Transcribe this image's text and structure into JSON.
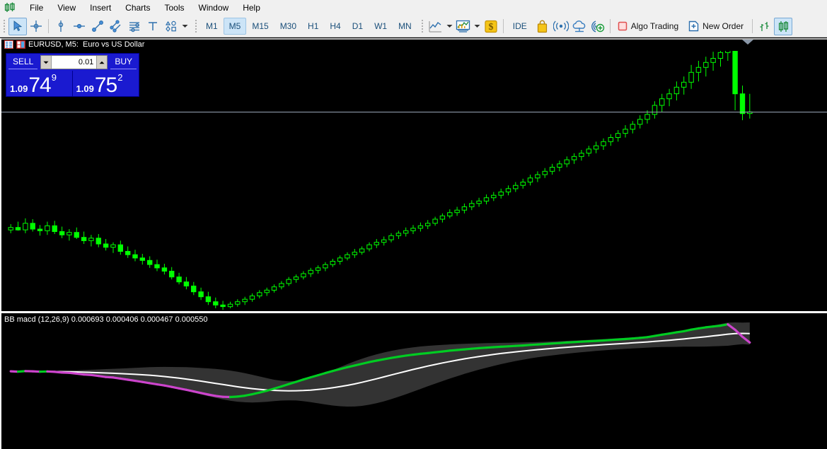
{
  "app": {
    "logo_icon": "candlestick-logo-icon"
  },
  "menubar": {
    "items": [
      {
        "label": "File"
      },
      {
        "label": "View"
      },
      {
        "label": "Insert"
      },
      {
        "label": "Charts"
      },
      {
        "label": "Tools"
      },
      {
        "label": "Window"
      },
      {
        "label": "Help"
      }
    ]
  },
  "toolbar": {
    "cursor_icon": "arrow-cursor-icon",
    "crosshair_icon": "crosshair-icon",
    "vertical_line_icon": "vertical-line-icon",
    "horizontal_line_icon": "horizontal-line-icon",
    "trendline_icon": "trendline-icon",
    "equidistant_channel_icon": "equidistant-channel-icon",
    "fibonacci_icon": "fibonacci-retracement-icon",
    "text_icon": "text-tool-icon",
    "shapes_icon": "shapes-icon",
    "shapes_caret_icon": "chevron-down-icon",
    "timeframes": [
      {
        "label": "M1",
        "active": false
      },
      {
        "label": "M5",
        "active": true
      },
      {
        "label": "M15",
        "active": false
      },
      {
        "label": "M30",
        "active": false
      },
      {
        "label": "H1",
        "active": false
      },
      {
        "label": "H4",
        "active": false
      },
      {
        "label": "D1",
        "active": false
      },
      {
        "label": "W1",
        "active": false
      },
      {
        "label": "MN",
        "active": false
      }
    ],
    "line_chart_icon": "line-chart-icon",
    "line_chart_caret_icon": "chevron-down-icon",
    "indicators_icon": "indicators-icon",
    "indicators_caret_icon": "chevron-down-icon",
    "autotrading_icon": "dollar-badge-icon",
    "ide_label": "IDE",
    "market_icon": "shopping-bag-icon",
    "signals_icon": "signals-broadcast-icon",
    "cloud_icon": "cloud-upload-icon",
    "vps_icon": "vps-add-icon",
    "algo_trading_label": "Algo Trading",
    "algo_trading_icon": "stop-square-icon",
    "new_order_label": "New Order",
    "new_order_icon": "new-document-plus-icon",
    "bar_chart_icon": "bar-chart-icon",
    "candlestick_icon": "candlestick-chart-icon",
    "candlestick_active": true
  },
  "chart": {
    "title": "EURUSD, M5:  Euro vs US Dollar",
    "properties_icon": "chart-properties-icon",
    "symbol_icon": "symbol-window-icon",
    "symbol": "EURUSD",
    "timeframe": "M5",
    "description": "Euro vs US Dollar",
    "background_color": "#000000",
    "bull_candle_color": "#00ff00",
    "bear_candle_color": "#00ff00",
    "price_line_color": "#9aa7b8",
    "scroll_marker_icon": "scroll-position-marker-icon"
  },
  "trading_panel": {
    "sell_label": "SELL",
    "buy_label": "BUY",
    "volume_value": "0.01",
    "volume_placeholder": "0.01",
    "spin_down_icon": "chevron-down-icon",
    "spin_up_icon": "chevron-up-icon",
    "sell_price": {
      "prefix": "1.09",
      "big": "74",
      "sup": "9"
    },
    "buy_price": {
      "prefix": "1.09",
      "big": "75",
      "sup": "2"
    },
    "panel_color": "#1a1ad0"
  },
  "indicator": {
    "label": "BB macd (12,26,9) 0.000693 0.000406 0.000467 0.000550",
    "name": "BB macd",
    "params": "(12,26,9)",
    "values": [
      "0.000693",
      "0.000406",
      "0.000467",
      "0.000550"
    ],
    "band_color": "#333333",
    "signal_color": "#ffffff",
    "rising_color": "#00cc22",
    "falling_color": "#cc44cc"
  },
  "chart_data": {
    "type": "candlestick",
    "title": "EURUSD, M5:  Euro vs US Dollar",
    "xlabel": "",
    "ylabel": "",
    "grid": false,
    "ylim": [
      1.0928,
      1.0988
    ],
    "price_line": 1.09752,
    "candles": [
      {
        "o": 1.0947,
        "h": 1.09484,
        "l": 1.09462,
        "c": 1.09476
      },
      {
        "o": 1.09476,
        "h": 1.0949,
        "l": 1.09468,
        "c": 1.0947
      },
      {
        "o": 1.0947,
        "h": 1.09498,
        "l": 1.09462,
        "c": 1.09486
      },
      {
        "o": 1.09486,
        "h": 1.09496,
        "l": 1.09466,
        "c": 1.09472
      },
      {
        "o": 1.09472,
        "h": 1.09482,
        "l": 1.09456,
        "c": 1.09468
      },
      {
        "o": 1.09468,
        "h": 1.0949,
        "l": 1.09458,
        "c": 1.0948
      },
      {
        "o": 1.0948,
        "h": 1.09492,
        "l": 1.0946,
        "c": 1.09466
      },
      {
        "o": 1.09466,
        "h": 1.09478,
        "l": 1.0945,
        "c": 1.09458
      },
      {
        "o": 1.09458,
        "h": 1.09472,
        "l": 1.09444,
        "c": 1.09464
      },
      {
        "o": 1.09464,
        "h": 1.09476,
        "l": 1.09448,
        "c": 1.09452
      },
      {
        "o": 1.09452,
        "h": 1.09466,
        "l": 1.09436,
        "c": 1.09444
      },
      {
        "o": 1.09444,
        "h": 1.09458,
        "l": 1.0943,
        "c": 1.0945
      },
      {
        "o": 1.0945,
        "h": 1.0946,
        "l": 1.09428,
        "c": 1.09436
      },
      {
        "o": 1.09436,
        "h": 1.09448,
        "l": 1.0942,
        "c": 1.09428
      },
      {
        "o": 1.09428,
        "h": 1.0944,
        "l": 1.09414,
        "c": 1.09434
      },
      {
        "o": 1.09434,
        "h": 1.09444,
        "l": 1.0941,
        "c": 1.09418
      },
      {
        "o": 1.09418,
        "h": 1.0943,
        "l": 1.09402,
        "c": 1.0941
      },
      {
        "o": 1.0941,
        "h": 1.09422,
        "l": 1.09394,
        "c": 1.09402
      },
      {
        "o": 1.09402,
        "h": 1.09412,
        "l": 1.09386,
        "c": 1.09396
      },
      {
        "o": 1.09396,
        "h": 1.09406,
        "l": 1.09378,
        "c": 1.09386
      },
      {
        "o": 1.09386,
        "h": 1.09398,
        "l": 1.0937,
        "c": 1.09378
      },
      {
        "o": 1.09378,
        "h": 1.09388,
        "l": 1.09362,
        "c": 1.0937
      },
      {
        "o": 1.0937,
        "h": 1.0938,
        "l": 1.0935,
        "c": 1.09356
      },
      {
        "o": 1.09356,
        "h": 1.09366,
        "l": 1.09338,
        "c": 1.09344
      },
      {
        "o": 1.09344,
        "h": 1.09356,
        "l": 1.09326,
        "c": 1.09334
      },
      {
        "o": 1.09334,
        "h": 1.09344,
        "l": 1.09312,
        "c": 1.0932
      },
      {
        "o": 1.0932,
        "h": 1.0933,
        "l": 1.093,
        "c": 1.09308
      },
      {
        "o": 1.09308,
        "h": 1.0932,
        "l": 1.09288,
        "c": 1.09296
      },
      {
        "o": 1.09296,
        "h": 1.09306,
        "l": 1.0928,
        "c": 1.09288
      },
      {
        "o": 1.09288,
        "h": 1.09298,
        "l": 1.09276,
        "c": 1.09284
      },
      {
        "o": 1.09284,
        "h": 1.09296,
        "l": 1.0928,
        "c": 1.0929
      },
      {
        "o": 1.0929,
        "h": 1.09302,
        "l": 1.09284,
        "c": 1.09296
      },
      {
        "o": 1.09296,
        "h": 1.09308,
        "l": 1.09288,
        "c": 1.09302
      },
      {
        "o": 1.09302,
        "h": 1.09316,
        "l": 1.09296,
        "c": 1.0931
      },
      {
        "o": 1.0931,
        "h": 1.09324,
        "l": 1.09304,
        "c": 1.09318
      },
      {
        "o": 1.09318,
        "h": 1.0933,
        "l": 1.0931,
        "c": 1.09324
      },
      {
        "o": 1.09324,
        "h": 1.09338,
        "l": 1.09318,
        "c": 1.09332
      },
      {
        "o": 1.09332,
        "h": 1.09346,
        "l": 1.09326,
        "c": 1.0934
      },
      {
        "o": 1.0934,
        "h": 1.09356,
        "l": 1.09334,
        "c": 1.0935
      },
      {
        "o": 1.0935,
        "h": 1.09362,
        "l": 1.09342,
        "c": 1.09356
      },
      {
        "o": 1.09356,
        "h": 1.0937,
        "l": 1.0935,
        "c": 1.09364
      },
      {
        "o": 1.09364,
        "h": 1.09378,
        "l": 1.09356,
        "c": 1.09372
      },
      {
        "o": 1.09372,
        "h": 1.09384,
        "l": 1.09364,
        "c": 1.09378
      },
      {
        "o": 1.09378,
        "h": 1.09392,
        "l": 1.0937,
        "c": 1.09386
      },
      {
        "o": 1.09386,
        "h": 1.094,
        "l": 1.0938,
        "c": 1.09394
      },
      {
        "o": 1.09394,
        "h": 1.09408,
        "l": 1.09386,
        "c": 1.09402
      },
      {
        "o": 1.09402,
        "h": 1.09416,
        "l": 1.09396,
        "c": 1.0941
      },
      {
        "o": 1.0941,
        "h": 1.09424,
        "l": 1.09402,
        "c": 1.09416
      },
      {
        "o": 1.09416,
        "h": 1.0943,
        "l": 1.0941,
        "c": 1.09424
      },
      {
        "o": 1.09424,
        "h": 1.0944,
        "l": 1.09418,
        "c": 1.09434
      },
      {
        "o": 1.09434,
        "h": 1.09448,
        "l": 1.09426,
        "c": 1.0944
      },
      {
        "o": 1.0944,
        "h": 1.09454,
        "l": 1.09432,
        "c": 1.09446
      },
      {
        "o": 1.09446,
        "h": 1.09462,
        "l": 1.0944,
        "c": 1.09456
      },
      {
        "o": 1.09456,
        "h": 1.09468,
        "l": 1.09448,
        "c": 1.09462
      },
      {
        "o": 1.09462,
        "h": 1.09476,
        "l": 1.09454,
        "c": 1.09468
      },
      {
        "o": 1.09468,
        "h": 1.09482,
        "l": 1.0946,
        "c": 1.09474
      },
      {
        "o": 1.09474,
        "h": 1.09488,
        "l": 1.09466,
        "c": 1.0948
      },
      {
        "o": 1.0948,
        "h": 1.09494,
        "l": 1.09472,
        "c": 1.09486
      },
      {
        "o": 1.09486,
        "h": 1.09502,
        "l": 1.0948,
        "c": 1.09496
      },
      {
        "o": 1.09496,
        "h": 1.0951,
        "l": 1.09488,
        "c": 1.09504
      },
      {
        "o": 1.09504,
        "h": 1.0952,
        "l": 1.09498,
        "c": 1.09512
      },
      {
        "o": 1.09512,
        "h": 1.09526,
        "l": 1.09504,
        "c": 1.09518
      },
      {
        "o": 1.09518,
        "h": 1.09534,
        "l": 1.0951,
        "c": 1.09526
      },
      {
        "o": 1.09526,
        "h": 1.09542,
        "l": 1.09518,
        "c": 1.09534
      },
      {
        "o": 1.09534,
        "h": 1.09548,
        "l": 1.09526,
        "c": 1.0954
      },
      {
        "o": 1.0954,
        "h": 1.09556,
        "l": 1.09532,
        "c": 1.09548
      },
      {
        "o": 1.09548,
        "h": 1.09562,
        "l": 1.0954,
        "c": 1.09554
      },
      {
        "o": 1.09554,
        "h": 1.0957,
        "l": 1.09546,
        "c": 1.09562
      },
      {
        "o": 1.09562,
        "h": 1.09578,
        "l": 1.09554,
        "c": 1.0957
      },
      {
        "o": 1.0957,
        "h": 1.09586,
        "l": 1.09562,
        "c": 1.09578
      },
      {
        "o": 1.09578,
        "h": 1.09594,
        "l": 1.0957,
        "c": 1.09586
      },
      {
        "o": 1.09586,
        "h": 1.09604,
        "l": 1.09578,
        "c": 1.09596
      },
      {
        "o": 1.09596,
        "h": 1.09612,
        "l": 1.09586,
        "c": 1.09604
      },
      {
        "o": 1.09604,
        "h": 1.0962,
        "l": 1.09596,
        "c": 1.09612
      },
      {
        "o": 1.09612,
        "h": 1.0963,
        "l": 1.09604,
        "c": 1.09622
      },
      {
        "o": 1.09622,
        "h": 1.09638,
        "l": 1.09612,
        "c": 1.0963
      },
      {
        "o": 1.0963,
        "h": 1.09648,
        "l": 1.09622,
        "c": 1.0964
      },
      {
        "o": 1.0964,
        "h": 1.09656,
        "l": 1.0963,
        "c": 1.09648
      },
      {
        "o": 1.09648,
        "h": 1.09664,
        "l": 1.09638,
        "c": 1.09656
      },
      {
        "o": 1.09656,
        "h": 1.09674,
        "l": 1.09648,
        "c": 1.09666
      },
      {
        "o": 1.09666,
        "h": 1.09684,
        "l": 1.09656,
        "c": 1.09674
      },
      {
        "o": 1.09674,
        "h": 1.09692,
        "l": 1.09664,
        "c": 1.09684
      },
      {
        "o": 1.09684,
        "h": 1.09702,
        "l": 1.09674,
        "c": 1.09694
      },
      {
        "o": 1.09694,
        "h": 1.09712,
        "l": 1.09684,
        "c": 1.09704
      },
      {
        "o": 1.09704,
        "h": 1.09724,
        "l": 1.09694,
        "c": 1.09714
      },
      {
        "o": 1.09714,
        "h": 1.09734,
        "l": 1.09704,
        "c": 1.09726
      },
      {
        "o": 1.09726,
        "h": 1.09748,
        "l": 1.09716,
        "c": 1.09738
      },
      {
        "o": 1.09738,
        "h": 1.0976,
        "l": 1.09728,
        "c": 1.0975
      },
      {
        "o": 1.0975,
        "h": 1.09782,
        "l": 1.0974,
        "c": 1.09772
      },
      {
        "o": 1.09772,
        "h": 1.098,
        "l": 1.09756,
        "c": 1.09788
      },
      {
        "o": 1.09788,
        "h": 1.09812,
        "l": 1.0977,
        "c": 1.098
      },
      {
        "o": 1.098,
        "h": 1.0983,
        "l": 1.09784,
        "c": 1.09816
      },
      {
        "o": 1.09816,
        "h": 1.09842,
        "l": 1.09798,
        "c": 1.09828
      },
      {
        "o": 1.09828,
        "h": 1.0987,
        "l": 1.09812,
        "c": 1.09852
      },
      {
        "o": 1.09852,
        "h": 1.0988,
        "l": 1.0983,
        "c": 1.09864
      },
      {
        "o": 1.09864,
        "h": 1.0989,
        "l": 1.09842,
        "c": 1.09876
      },
      {
        "o": 1.09876,
        "h": 1.09902,
        "l": 1.09856,
        "c": 1.09886
      },
      {
        "o": 1.09886,
        "h": 1.09914,
        "l": 1.09866,
        "c": 1.099
      },
      {
        "o": 1.099,
        "h": 1.0994,
        "l": 1.0988,
        "c": 1.09926
      },
      {
        "o": 1.09926,
        "h": 1.09948,
        "l": 1.0976,
        "c": 1.098
      },
      {
        "o": 1.098,
        "h": 1.0982,
        "l": 1.09736,
        "c": 1.09752
      },
      {
        "o": 1.09752,
        "h": 1.098,
        "l": 1.0974,
        "c": 1.09756
      }
    ],
    "indicator_panel": {
      "type": "line",
      "name": "BB macd (12,26,9)",
      "series": [
        {
          "name": "MACD",
          "color_rising": "#00cc22",
          "color_falling": "#cc44cc"
        },
        {
          "name": "Signal",
          "color": "#ffffff"
        },
        {
          "name": "Bollinger Band",
          "color": "#333333"
        }
      ],
      "values": [
        "0.000693",
        "0.000406",
        "0.000467",
        "0.000550"
      ]
    }
  }
}
